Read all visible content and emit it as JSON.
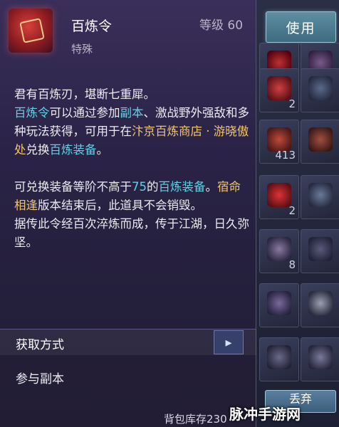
{
  "item": {
    "name": "百炼令",
    "type": "特殊",
    "level": "等级 60",
    "description": [
      [
        {
          "t": "君有百炼刃，堪断七重犀。",
          "c": ""
        }
      ],
      [
        {
          "t": "百炼令",
          "c": "cyan"
        },
        {
          "t": "可以通过参加",
          "c": ""
        },
        {
          "t": "副本",
          "c": "cyan"
        },
        {
          "t": "、激战野外强敌和多种玩法获得，可用于在",
          "c": ""
        },
        {
          "t": "汴京百炼商店 · 游晓傲处",
          "c": "gold"
        },
        {
          "t": "兑换",
          "c": ""
        },
        {
          "t": "百炼装备",
          "c": "cyan"
        },
        {
          "t": "。",
          "c": ""
        }
      ],
      [],
      [
        {
          "t": "可兑换装备等阶不高于",
          "c": ""
        },
        {
          "t": "75",
          "c": "cyan"
        },
        {
          "t": "的",
          "c": ""
        },
        {
          "t": "百炼装备",
          "c": "cyan"
        },
        {
          "t": "。",
          "c": ""
        },
        {
          "t": "宿命相逢",
          "c": "gold"
        },
        {
          "t": "版本结束后，此道具不会销毁。",
          "c": ""
        }
      ],
      [
        {
          "t": "据传此令经百次淬炼而成，传于江湖，日久弥坚。",
          "c": ""
        }
      ]
    ]
  },
  "acquire": {
    "label": "获取方式",
    "sources": [
      "参与副本"
    ]
  },
  "actions": {
    "use_label": "使用",
    "partial_label": "丢弃"
  },
  "inventory": {
    "counts": [
      "2",
      "2",
      "413",
      "2",
      "8",
      "",
      ""
    ],
    "storage_label": "背包库存230"
  },
  "watermark": "脉冲手游网",
  "colors": {
    "highlight_cyan": "#5fd2e6",
    "highlight_gold": "#f2c46a"
  }
}
